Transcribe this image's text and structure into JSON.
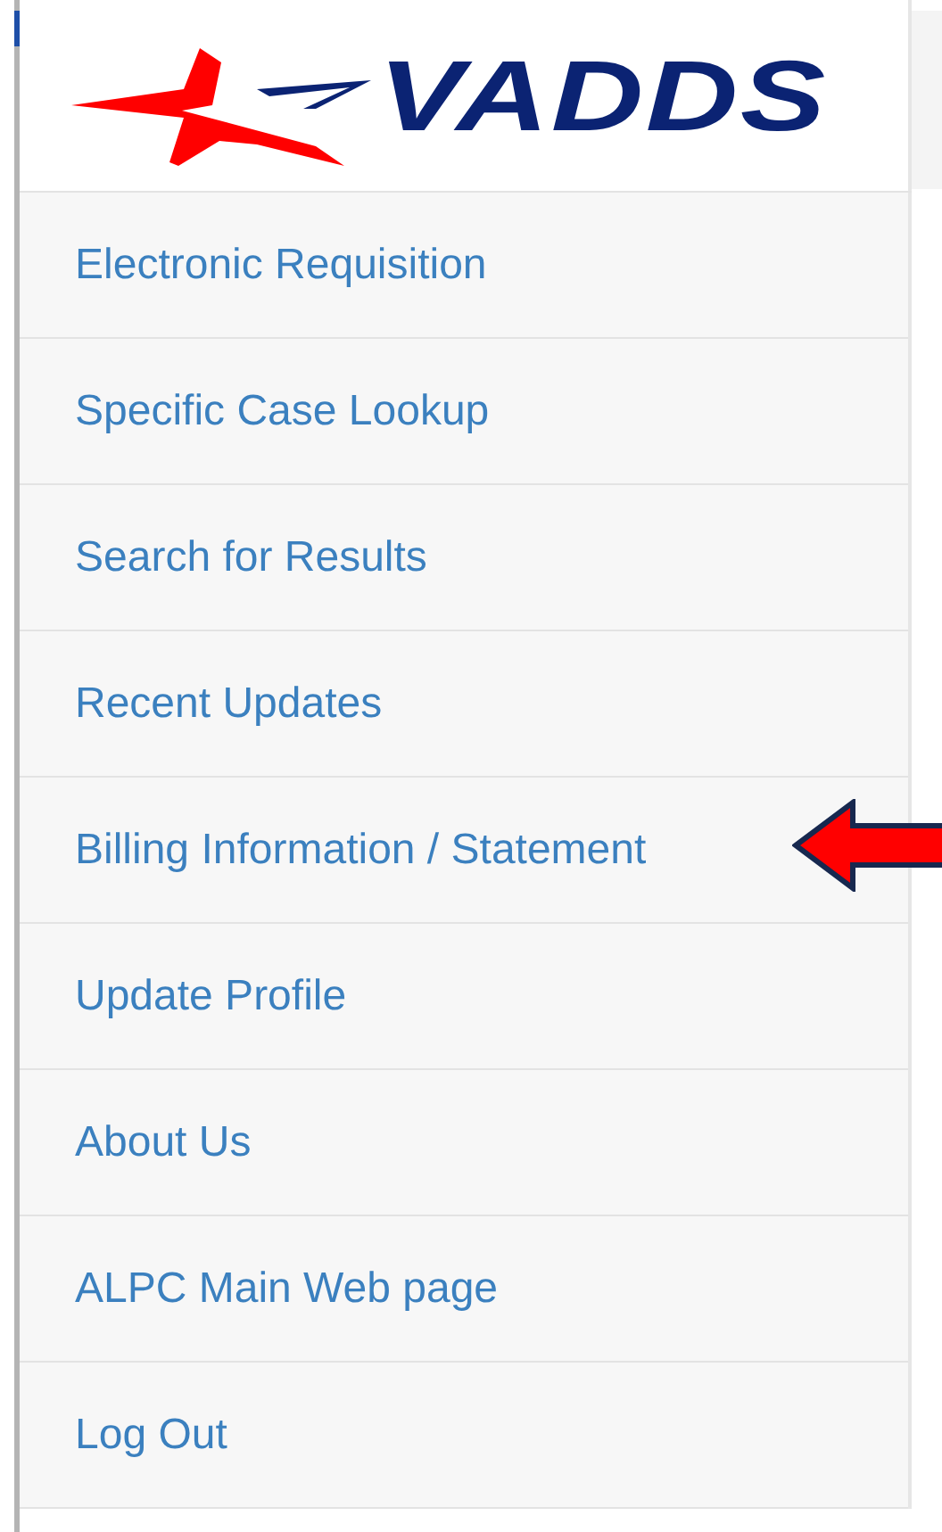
{
  "logo": {
    "text": "VADDS"
  },
  "menu": [
    {
      "label": "Electronic Requisition",
      "pointed": false
    },
    {
      "label": "Specific Case Lookup",
      "pointed": false
    },
    {
      "label": "Search for Results",
      "pointed": false
    },
    {
      "label": "Recent Updates",
      "pointed": false
    },
    {
      "label": "Billing Information / Statement",
      "pointed": true
    },
    {
      "label": "Update Profile",
      "pointed": false
    },
    {
      "label": "About Us",
      "pointed": false
    },
    {
      "label": "ALPC Main Web page",
      "pointed": false
    },
    {
      "label": "Log Out",
      "pointed": false
    }
  ]
}
